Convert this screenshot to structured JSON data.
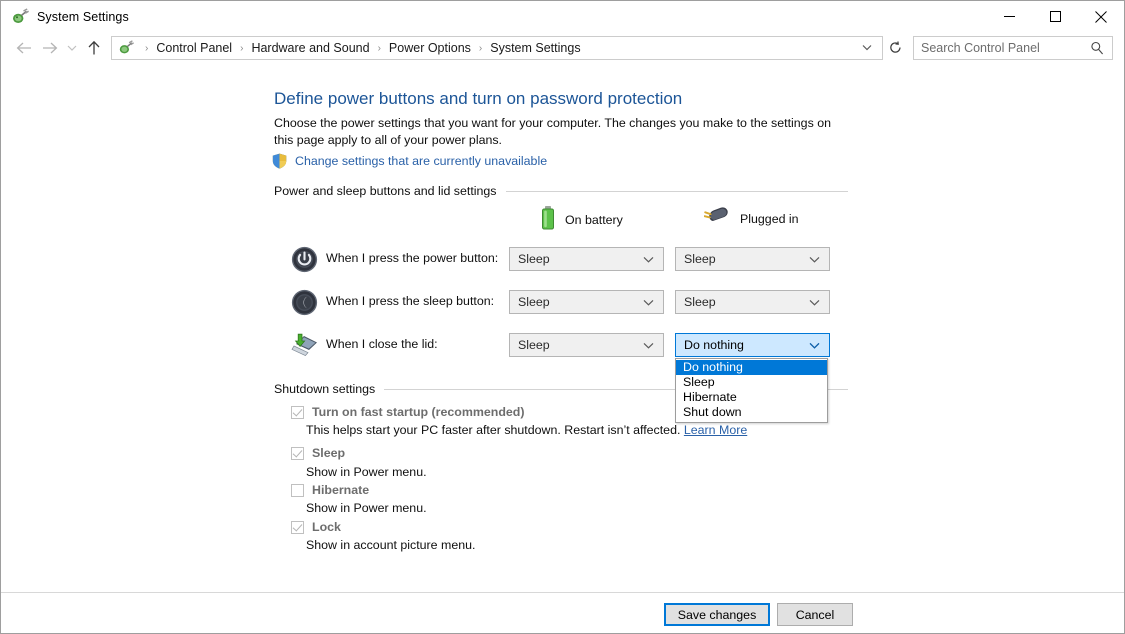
{
  "window": {
    "title": "System Settings",
    "icon": "power-plug-icon",
    "controls": {
      "minimize": "minimize-icon",
      "maximize": "maximize-icon",
      "close": "close-icon"
    }
  },
  "addressbar": {
    "back": "back-arrow-icon",
    "forward": "forward-arrow-icon",
    "recent": "chevron-down-icon",
    "up": "up-arrow-icon",
    "breadcrumb": [
      "Control Panel",
      "Hardware and Sound",
      "Power Options",
      "System Settings"
    ],
    "separator": "›",
    "refresh": "refresh-icon",
    "search": {
      "placeholder": "Search Control Panel",
      "value": "",
      "icon": "search-icon"
    }
  },
  "page": {
    "title": "Define power buttons and turn on password protection",
    "description": "Choose the power settings that you want for your computer. The changes you make to the settings on this page apply to all of your power plans.",
    "admin_link": "Change settings that are currently unavailable"
  },
  "power_section": {
    "header": "Power and sleep buttons and lid settings",
    "columns": [
      {
        "label": "On battery",
        "icon": "battery-icon"
      },
      {
        "label": "Plugged in",
        "icon": "power-plug-icon"
      }
    ],
    "rows": [
      {
        "icon": "power-button-icon",
        "label": "When I press the power button:",
        "on_battery": "Sleep",
        "plugged_in": "Sleep",
        "disabled": true
      },
      {
        "icon": "sleep-button-icon",
        "label": "When I press the sleep button:",
        "on_battery": "Sleep",
        "plugged_in": "Sleep",
        "disabled": true
      },
      {
        "icon": "laptop-lid-icon",
        "label": "When I close the lid:",
        "on_battery": "Sleep",
        "plugged_in": "Do nothing",
        "disabled": true
      }
    ],
    "open_dropdown": {
      "selected": "Do nothing",
      "options": [
        "Do nothing",
        "Sleep",
        "Hibernate",
        "Shut down"
      ]
    }
  },
  "shutdown_section": {
    "header": "Shutdown settings",
    "items": [
      {
        "label": "Turn on fast startup (recommended)",
        "checked": true,
        "description": "This helps start your PC faster after shutdown. Restart isn’t affected.",
        "link": "Learn More"
      },
      {
        "label": "Sleep",
        "checked": true,
        "description": "Show in Power menu.",
        "link": ""
      },
      {
        "label": "Hibernate",
        "checked": false,
        "description": "Show in Power menu.",
        "link": ""
      },
      {
        "label": "Lock",
        "checked": true,
        "description": "Show in account picture menu.",
        "link": ""
      }
    ]
  },
  "footer": {
    "save": "Save changes",
    "cancel": "Cancel"
  },
  "colors": {
    "accent": "#0078d7",
    "link": "#2a61a8",
    "title": "#1c5597",
    "highlight": "#0078d7",
    "combo_open_bg": "#cde8ff",
    "disabled_text": "#6d6d6d"
  }
}
